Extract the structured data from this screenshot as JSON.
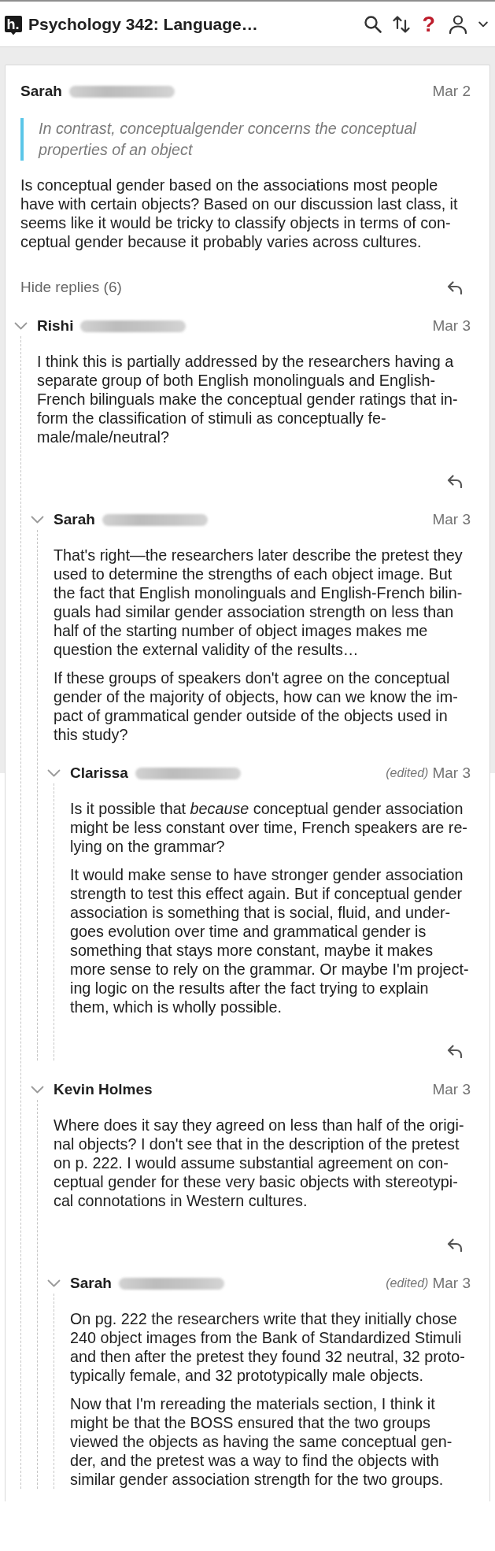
{
  "header": {
    "logo": "h.",
    "title": "Psychology 342: Language…",
    "help": "?"
  },
  "annotation": {
    "author": "Sarah",
    "surname_blurred": true,
    "date": "Mar 2",
    "quote": "In contrast, conceptualgender concerns the conceptual properties of an object",
    "paragraphs": [
      "Is conceptual gender based on the associations most people have with certain objects? Based on our discussion last class, it seems like it would be tricky to classify objects in terms of con-ceptual gender because it probably varies across cultures."
    ],
    "replies_toggle": "Hide replies (6)",
    "reply_button": true,
    "replies": [
      {
        "author": "Rishi",
        "surname_blurred": true,
        "date": "Mar 3",
        "expanded": true,
        "paragraphs": [
          "I think this is partially addressed by the researchers having a separate group of both English monolinguals and English-French bilinguals make the conceptual gender ratings that in-form the classification of stimuli as conceptually fe-male/male/neutral?"
        ],
        "reply_button": true,
        "children": [
          {
            "author": "Sarah",
            "surname_blurred": true,
            "date": "Mar 3",
            "expanded": true,
            "paragraphs": [
              "That's right—the researchers later describe the pretest they used to determine the strengths of each object image. But the fact that English monolinguals and English-French bilin-guals had similar gender association strength on less than half of the starting number of object images makes me question the external validity of the results…",
              "If these groups of speakers don't agree on the conceptual gender of the majority of objects, how can we know the im-pact of grammatical gender outside of the objects used in this study?"
            ],
            "reply_button": false,
            "children": [
              {
                "author": "Clarissa",
                "surname_blurred": true,
                "edited": "(edited)",
                "date": "Mar 3",
                "expanded": true,
                "paragraphs": [
                  "Is it possible that *because* conceptual gender association might be less constant over time, French speakers are re-lying on the grammar?",
                  "It would make sense to have stronger gender association strength to test this effect again. But if conceptual gender association is something that is social, fluid, and under-goes evolution over time and grammatical gender is something that stays more constant, maybe it makes more sense to rely on the grammar. Or maybe I'm project-ing logic on the results after the fact trying to explain them, which is wholly possible."
                ],
                "reply_button": true
              }
            ]
          },
          {
            "author": "Kevin Holmes",
            "surname_blurred": false,
            "date": "Mar 3",
            "expanded": true,
            "paragraphs": [
              "Where does it say they agreed on less than half of the origi-nal objects? I don't see that in the description of the pretest on p. 222. I would assume substantial agreement on con-ceptual gender for these very basic objects with stereotypi-cal connotations in Western cultures."
            ],
            "reply_button": true,
            "children": [
              {
                "author": "Sarah",
                "surname_blurred": true,
                "edited": "(edited)",
                "date": "Mar 3",
                "expanded": true,
                "paragraphs": [
                  "On pg. 222 the researchers write that they initially chose 240 object images from the Bank of Standardized Stimuli and then after the pretest they found 32 neutral, 32 proto-typically female, and 32 prototypically male objects.",
                  "Now that I'm rereading the materials section, I think it might be that the BOSS ensured that the two groups viewed the objects as having the same conceptual gen-der, and the pretest was a way to find the objects with similar gender association strength for the two groups."
                ],
                "reply_button": false
              }
            ]
          }
        ]
      }
    ]
  }
}
